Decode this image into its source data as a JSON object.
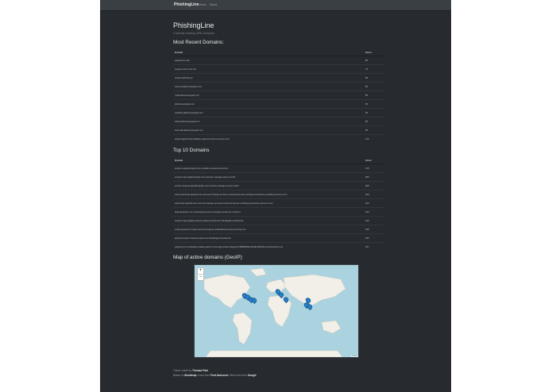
{
  "navbar": {
    "brand": "PhishingLine",
    "links": [
      "Home",
      "About"
    ]
  },
  "header": {
    "title": "PhishingLine",
    "subtitle": "Currently tracking 1694 domains"
  },
  "recent": {
    "heading": "Most Recent Domains:",
    "columns": [
      "Domain",
      "Score"
    ],
    "rows": [
      [
        "paypal-sec.site",
        "85"
      ],
      [
        "support-accnt.com.au",
        "75"
      ],
      [
        "cpanel.plzhelp.top",
        "85"
      ],
      [
        "secure.platinumpaypal.com",
        "85"
      ],
      [
        "mail.platinumpaypal.com",
        "85"
      ],
      [
        "platinumpaypal.com",
        "80"
      ],
      [
        "webdisk.platinumpaypal.com",
        "90"
      ],
      [
        "www.platinumpaypal.com",
        "85"
      ],
      [
        "webmail.platinumpaypal.com",
        "85"
      ],
      [
        "www4.appleid-cancellation-payment-itunes-invoice.com",
        "115"
      ]
    ]
  },
  "top10": {
    "heading": "Top 10 Domains",
    "columns": [
      "Domain",
      "Score"
    ],
    "rows": [
      [
        "support-appleid-apple.com-update-renewal-account.tk",
        "215"
      ],
      [
        "support-app.appleid-apple.com-service-manage-secure.world",
        "205"
      ],
      [
        "service-support-appleid-apple.com-service-manage-secure.world",
        "205"
      ],
      [
        "www.www-help-appleid.com-account-change-services-customerservice-verifying-newdevice-pending-account.com",
        "200"
      ],
      [
        "www.help-appleid.com-account-change-services-customerservice-verifying-newdevice-account.com",
        "200"
      ],
      [
        "appleid-apple.com-unlocking-account-managementserver-verify.ml",
        "195"
      ],
      [
        "support-app.appleid-support-statementaccount-fraudlegal-unlocked.tk",
        "195"
      ],
      [
        "verify.paypal.com-login-security-support-verificationprocess-security.com",
        "195"
      ],
      [
        "appleid-support-statementaccount-fraudlegal-unlocked.tk",
        "185"
      ],
      [
        "paypal.com-worldwide-update-webscr-cmd-login-submit-dispatch-5885d80a13c0db1f8e263-unsubscribers.net",
        "187"
      ]
    ]
  },
  "map": {
    "heading": "Map of active domains (GeoIP)",
    "zoom_in": "+",
    "zoom_out": "−",
    "attribution": "Leaflet"
  },
  "footer": {
    "line1_prefix": "Theme made by",
    "line1_author": "Thomas Park",
    "line2_prefix": "Based on",
    "line2_b1": "Bootstrap",
    "line2_mid": ". Icons from",
    "line2_b2": "Font Awesome",
    "line2_mid2": ". Web fonts from",
    "line2_b3": "Google"
  }
}
